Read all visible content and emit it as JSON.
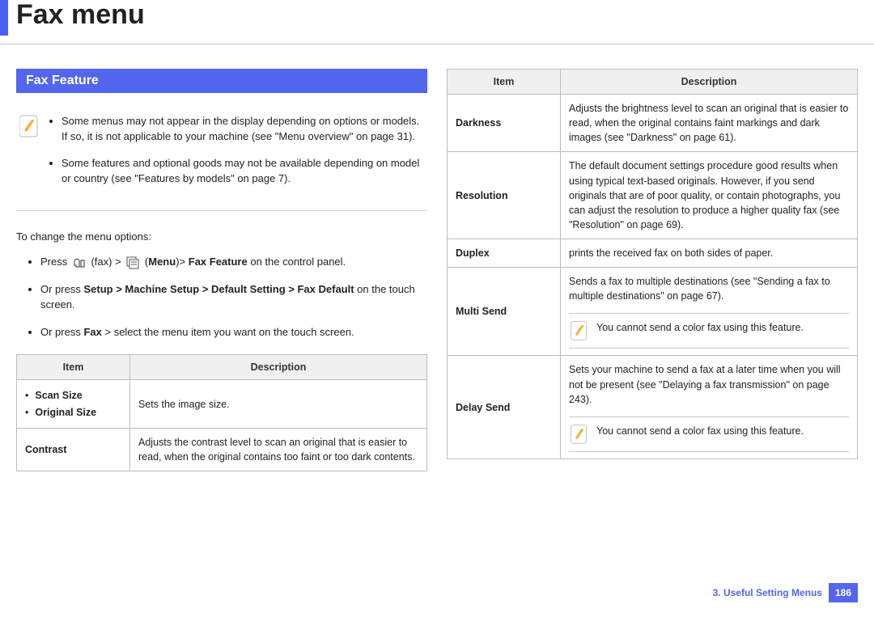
{
  "page_title": "Fax menu",
  "section_header": "Fax Feature",
  "notes": [
    "Some menus may not appear in the display depending on options or models. If so, it is not applicable to your machine (see \"Menu overview\" on page 31).",
    "Some features and optional goods may not be available depending on model or country (see \"Features by models\" on page 7)."
  ],
  "intro": "To change the menu options:",
  "steps": {
    "s1_pre": "Press ",
    "s1_mid": " (fax) > ",
    "s1_bold1": "Menu",
    "s1_mid2": ")> ",
    "s1_bold2": "Fax Feature",
    "s1_post": " on the control panel.",
    "s2_pre": "Or press ",
    "s2_bold": "Setup > Machine Setup > Default Setting > Fax Default",
    "s2_post": " on the touch screen.",
    "s3_pre": "Or press ",
    "s3_bold": "Fax",
    "s3_post": " > select the menu item you want on the touch screen."
  },
  "table_headers": {
    "item": "Item",
    "desc": "Description"
  },
  "left_rows": [
    {
      "items": [
        "Scan Size",
        "Original Size"
      ],
      "desc": "Sets the image size."
    },
    {
      "label": "Contrast",
      "desc": "Adjusts the contrast level to scan an original that is easier to read, when the original contains too faint or too dark contents."
    }
  ],
  "right_rows": [
    {
      "label": "Darkness",
      "desc": "Adjusts the brightness level to scan an original that is easier to read, when the original contains faint markings and dark images (see \"Darkness\" on page 61)."
    },
    {
      "label": "Resolution",
      "desc": "The default document settings procedure good results when using typical text-based originals. However, if you send originals that are of poor quality, or contain photographs, you can adjust the resolution to produce a higher quality fax (see \"Resolution\" on page 69)."
    },
    {
      "label": "Duplex",
      "desc": "prints the received fax on both sides of paper."
    },
    {
      "label": "Multi Send",
      "desc": "Sends a fax to multiple destinations (see \"Sending a fax to multiple destinations\" on page 67).",
      "note": "You cannot send a color fax using this feature."
    },
    {
      "label": "Delay Send",
      "desc": "Sets your machine to send a fax at a later time when you will not be present (see \"Delaying a fax transmission\" on page 243).",
      "note": "You cannot send a color fax using this feature."
    }
  ],
  "footer": {
    "chapter": "3.  Useful Setting Menus",
    "page": "186"
  }
}
